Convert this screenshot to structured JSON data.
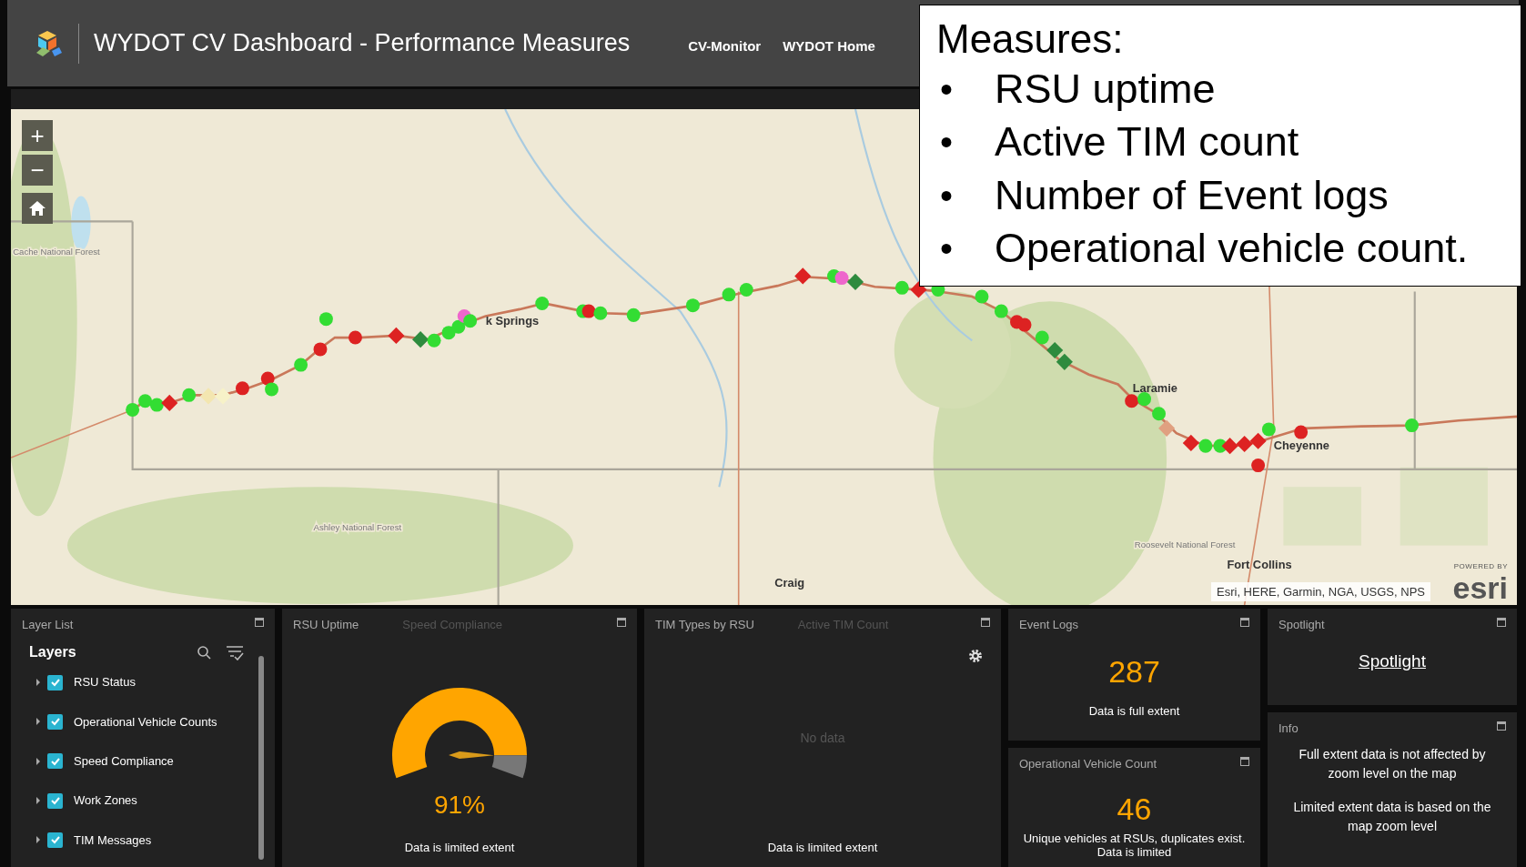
{
  "header": {
    "title": "WYDOT CV Dashboard - Performance Measures",
    "links": [
      "CV-Monitor",
      "WYDOT Home"
    ]
  },
  "map": {
    "zoom_in": "+",
    "zoom_out": "−",
    "labels": [
      {
        "text": "k Springs",
        "kind": "city"
      },
      {
        "text": "Laramie",
        "kind": "city"
      },
      {
        "text": "Cheyenne",
        "kind": "city"
      },
      {
        "text": "Fort Collins",
        "kind": "city"
      },
      {
        "text": "Craig",
        "kind": "city"
      },
      {
        "text": "Ashley National Forest",
        "kind": "forest"
      },
      {
        "text": "Roosevelt National Forest",
        "kind": "forest"
      },
      {
        "text": "Cache National Forest",
        "kind": "forest"
      }
    ],
    "attribution": "Esri, HERE, Garmin, NGA, USGS, NPS",
    "powered_by": "POWERED BY",
    "logo": "esri"
  },
  "callout": {
    "title": "Measures:",
    "items": [
      {
        "bullet": "•",
        "text": "RSU uptime"
      },
      {
        "bullet": "•",
        "text": "Active TIM count"
      },
      {
        "bullet": "•",
        "text": "Number of Event logs"
      },
      {
        "bullet": "•",
        "text": "Operational vehicle count."
      }
    ]
  },
  "layer_list": {
    "title": "Layer List",
    "heading": "Layers",
    "items": [
      {
        "label": "RSU Status",
        "checked": true
      },
      {
        "label": "Operational Vehicle Counts",
        "checked": true
      },
      {
        "label": "Speed Compliance",
        "checked": true
      },
      {
        "label": "Work Zones",
        "checked": true
      },
      {
        "label": "TIM Messages",
        "checked": true
      }
    ]
  },
  "uptime_panel": {
    "tabs": [
      {
        "label": "RSU Uptime",
        "selected": true
      },
      {
        "label": "Speed Compliance",
        "selected": false
      }
    ],
    "gauge": {
      "level": 0.91,
      "reading": "91%"
    },
    "note": "Data is limited extent"
  },
  "tim_panel": {
    "tabs": [
      {
        "label": "TIM Types by RSU",
        "selected": true
      },
      {
        "label": "Active TIM Count",
        "selected": false
      }
    ],
    "empty": "No data",
    "note": "Data is limited extent"
  },
  "event_logs": {
    "title": "Event Logs",
    "value": "287",
    "note": "Data is full extent"
  },
  "spotlight": {
    "title": "Spotlight",
    "link": "Spotlight"
  },
  "vehicle_count": {
    "title": "Operational Vehicle Count",
    "value": "46",
    "note": "Unique vehicles at RSUs, duplicates exist. Data is limited"
  },
  "info": {
    "title": "Info",
    "paragraphs": [
      "Full extent data is not affected by zoom level on the map",
      "Limited extent data is based on the map zoom level"
    ]
  }
}
